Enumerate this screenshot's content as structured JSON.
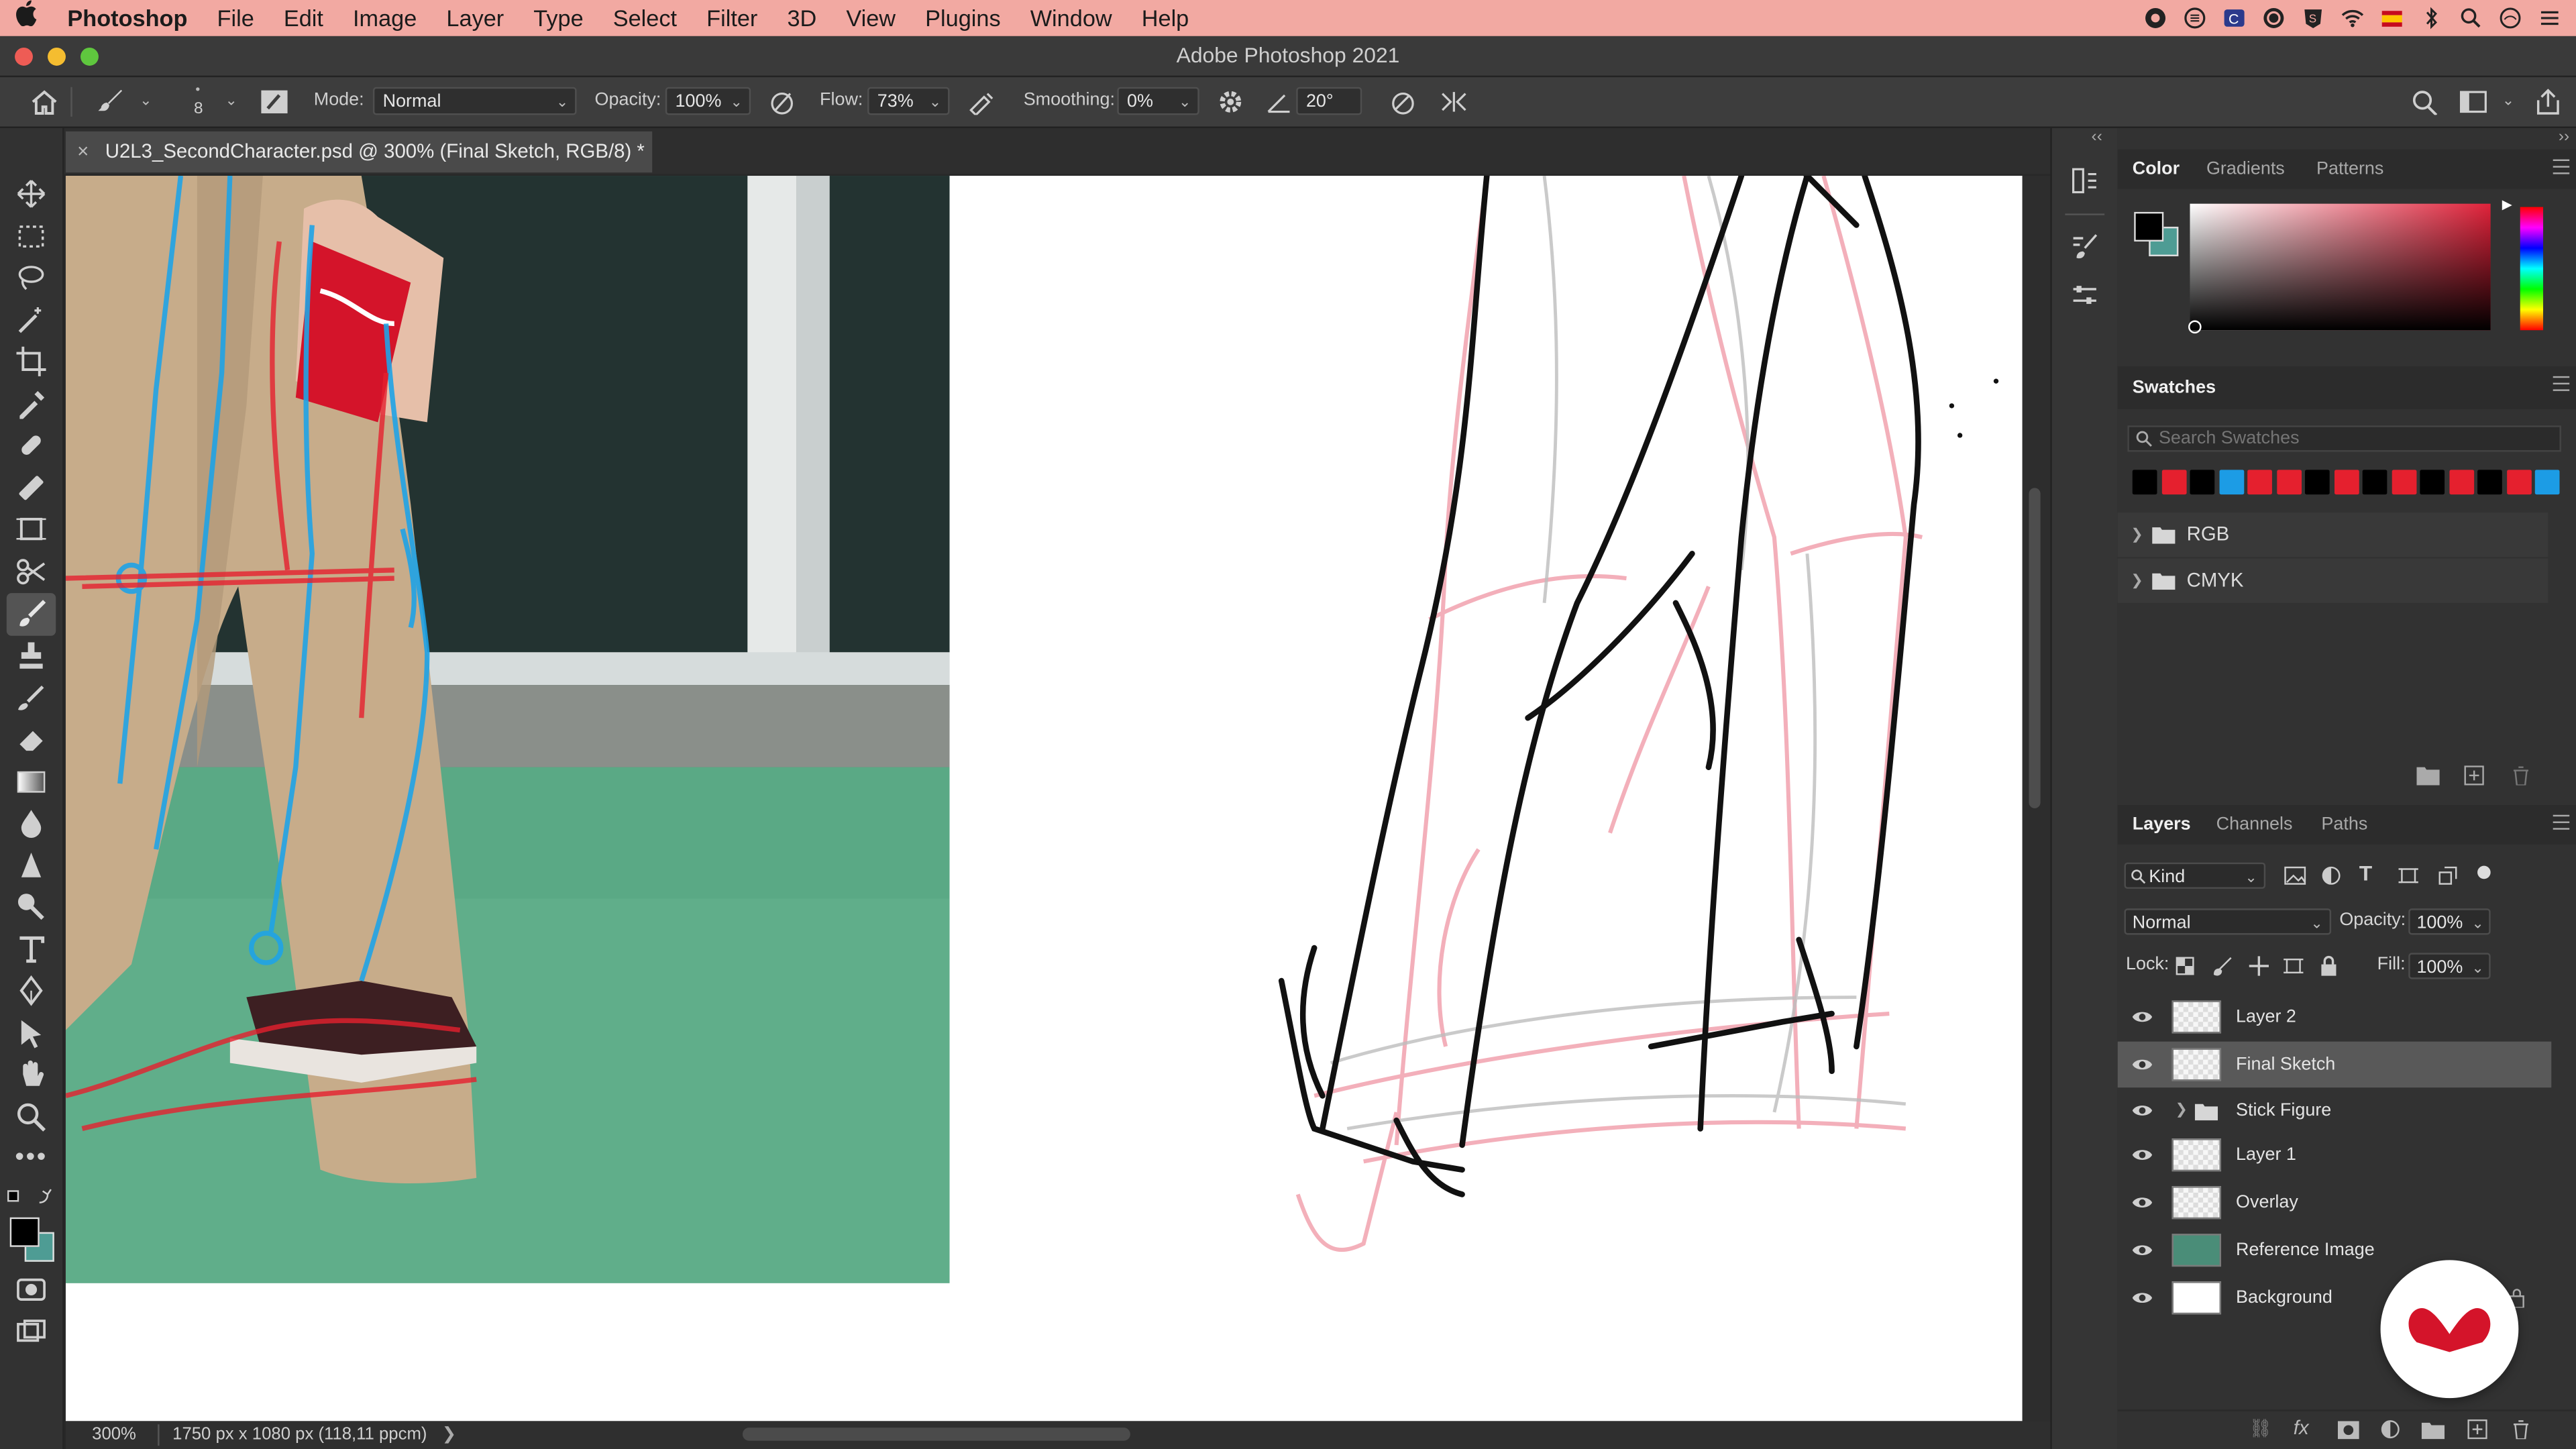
{
  "menubar": {
    "apple_icon": "apple-icon",
    "app_name": "Photoshop",
    "items": [
      "File",
      "Edit",
      "Image",
      "Layer",
      "Type",
      "Select",
      "Filter",
      "3D",
      "View",
      "Plugins",
      "Window",
      "Help"
    ]
  },
  "window": {
    "title": "Adobe Photoshop 2021"
  },
  "options_bar": {
    "brush_size": "8",
    "mode_label": "Mode:",
    "mode_value": "Normal",
    "opacity_label": "Opacity:",
    "opacity_value": "100%",
    "flow_label": "Flow:",
    "flow_value": "73%",
    "smoothing_label": "Smoothing:",
    "smoothing_value": "0%",
    "angle_value": "20°"
  },
  "document": {
    "tab_title": "U2L3_SecondCharacter.psd @ 300% (Final Sketch, RGB/8) *",
    "close_glyph": "×"
  },
  "status": {
    "zoom": "300%",
    "info": "1750 px x 1080 px (118,11 ppcm)",
    "arrow": "❯"
  },
  "color_panel": {
    "tabs": [
      "Color",
      "Gradients",
      "Patterns"
    ],
    "foreground": "#000000",
    "background": "#4e9c94"
  },
  "swatches_panel": {
    "title": "Swatches",
    "search_placeholder": "Search Swatches",
    "colors": [
      "#000000",
      "#e5202e",
      "#000000",
      "#1c9ce5",
      "#e5202e",
      "#e5202e",
      "#000000",
      "#e5202e",
      "#000000",
      "#e5202e",
      "#000000",
      "#e5202e",
      "#000000",
      "#e5202e",
      "#1c9ce5"
    ],
    "folders": [
      "RGB",
      "CMYK"
    ]
  },
  "layers_panel": {
    "tabs": [
      "Layers",
      "Channels",
      "Paths"
    ],
    "filter_kind": "Kind",
    "blend_mode": "Normal",
    "opacity_label": "Opacity:",
    "opacity_value": "100%",
    "lock_label": "Lock:",
    "fill_label": "Fill:",
    "fill_value": "100%",
    "layers": [
      {
        "name": "Layer 2",
        "selected": false
      },
      {
        "name": "Final Sketch",
        "selected": true
      },
      {
        "name": "Stick Figure",
        "selected": false,
        "group": true
      },
      {
        "name": "Layer 1",
        "selected": false
      },
      {
        "name": "Overlay",
        "selected": false
      },
      {
        "name": "Reference Image",
        "selected": false
      },
      {
        "name": "Background",
        "selected": false
      }
    ]
  },
  "brand_colors": {
    "menubar": "#f2a9a2",
    "accent_red": "#d4142a"
  }
}
